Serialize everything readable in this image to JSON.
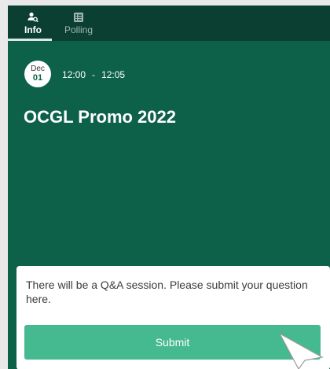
{
  "tabs": [
    {
      "label": "Info",
      "icon": "person-search-icon",
      "active": true
    },
    {
      "label": "Polling",
      "icon": "poll-list-icon",
      "active": false
    }
  ],
  "session": {
    "date_month": "Dec",
    "date_day": "01",
    "time_start": "12:00",
    "time_sep": "-",
    "time_end": "12:05",
    "title": "OCGL Promo 2022"
  },
  "qa": {
    "prompt": "There will be a Q&A session. Please submit your question here.",
    "submit_label": "Submit"
  },
  "colors": {
    "background": "#0d6149",
    "tabbar": "#0b3f31",
    "button": "#45b98f"
  }
}
